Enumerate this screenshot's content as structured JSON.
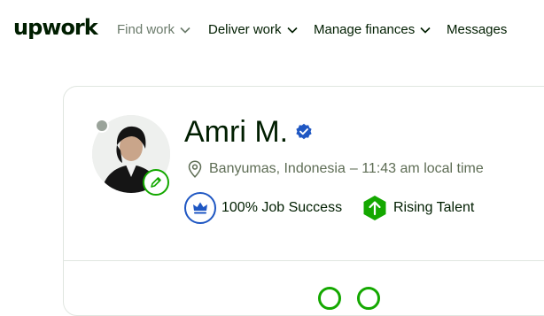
{
  "header": {
    "logo_text": "upwork",
    "nav": [
      {
        "label": "Find work",
        "icon": "chevron-down-icon"
      },
      {
        "label": "Deliver work",
        "icon": "chevron-down-icon"
      },
      {
        "label": "Manage finances",
        "icon": "chevron-down-icon"
      },
      {
        "label": "Messages"
      }
    ]
  },
  "profile": {
    "name": "Amri M.",
    "verified_icon": "verified-badge-icon",
    "location": "Banyumas, Indonesia",
    "local_time": "– 11:43 am local time",
    "status_icon": "offline-status-dot",
    "badges": {
      "job_success": "100% Job Success",
      "rising_talent": "Rising Talent"
    }
  },
  "colors": {
    "brand_green": "#14a800",
    "verified_blue": "#1f57c3",
    "text_dark": "#001e00",
    "text_muted": "#5e6d55"
  }
}
